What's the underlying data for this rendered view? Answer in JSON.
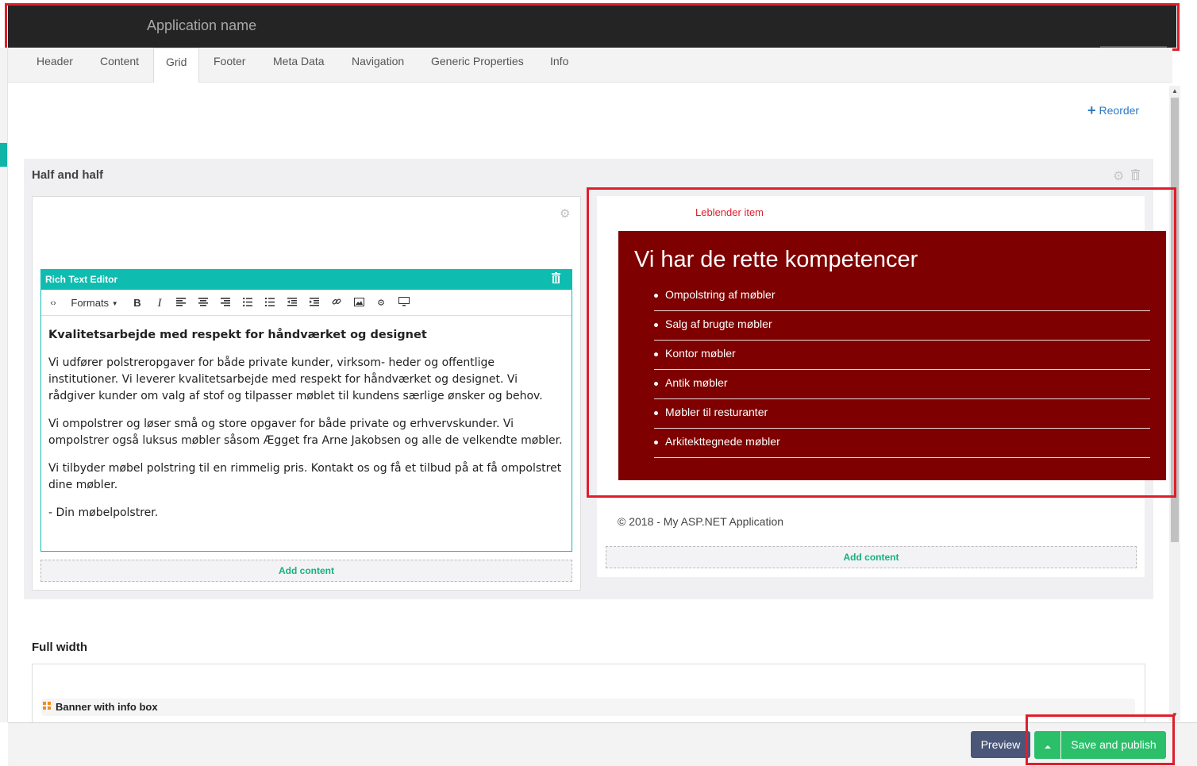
{
  "app": {
    "name": "Application name"
  },
  "tabs": [
    {
      "label": "Header",
      "active": false
    },
    {
      "label": "Content",
      "active": false
    },
    {
      "label": "Grid",
      "active": true
    },
    {
      "label": "Footer",
      "active": false
    },
    {
      "label": "Meta Data",
      "active": false
    },
    {
      "label": "Navigation",
      "active": false
    },
    {
      "label": "Generic Properties",
      "active": false
    },
    {
      "label": "Info",
      "active": false
    }
  ],
  "reorder": {
    "label": "Reorder",
    "icon": "plus-icon"
  },
  "half_section": {
    "title": "Half and half",
    "icons": [
      "gear-icon",
      "trash-icon"
    ],
    "left": {
      "editor_title": "Rich Text Editor",
      "toolbar": {
        "formats_label": "Formats",
        "bold": "B",
        "italic": "I",
        "icons": [
          "code-icon",
          "align-left-icon",
          "align-center-icon",
          "align-right-icon",
          "bullet-list-icon",
          "numbered-list-icon",
          "outdent-icon",
          "indent-icon",
          "link-icon",
          "image-icon",
          "macro-icon",
          "embed-icon"
        ]
      },
      "heading": "Kvalitetsarbejde med respekt for håndværket og designet",
      "paragraphs": [
        "Vi udfører polstreropgaver for både private kunder,  virksom- heder og offentlige institutioner. Vi leverer kvalitetsarbejde med respekt for håndværket og designet. Vi rådgiver kunder om valg af stof og tilpasser møblet til kundens særlige ønsker og behov.",
        "Vi ompolstrer og løser små og store opgaver for både private og erhvervskunder. Vi ompolstrer også luksus møbler såsom Ægget fra Arne Jakobsen og alle de velkendte møbler.",
        "Vi tilbyder møbel polstring til en rimmelig pris. Kontakt os og få et tilbud på at få ompolstret dine møbler.",
        "- Din møbelpolstrer."
      ],
      "add_content": "Add content"
    },
    "right": {
      "annotation": "Leblender item",
      "heading": "Vi har de rette kompetencer",
      "items": [
        "Ompolstring af møbler",
        "Salg af brugte møbler",
        "Kontor møbler",
        "Antik møbler",
        "Møbler til resturanter",
        "Arkitekttegnede møbler"
      ],
      "copyright": "© 2018 - My ASP.NET Application",
      "add_content": "Add content"
    }
  },
  "full_width": {
    "title": "Full width",
    "banner_label": "Banner with info box"
  },
  "footer": {
    "preview": "Preview",
    "save_publish": "Save and publish"
  },
  "colors": {
    "accent_teal": "#0fbcb0",
    "leblender_bg": "#7e0000",
    "annotation_red": "#e01e2b",
    "save_green": "#2bbf6a",
    "preview_blue": "#4a5778"
  }
}
